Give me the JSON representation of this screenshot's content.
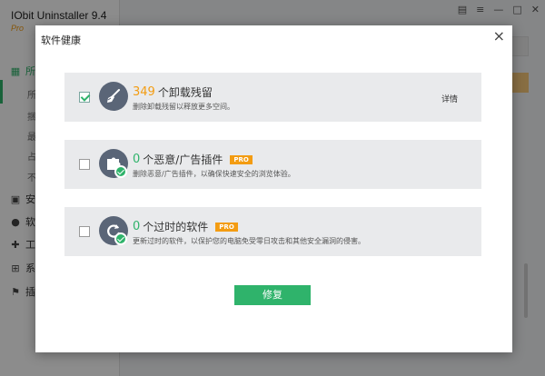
{
  "background_app": {
    "title": "IObit Uninstaller 9.4",
    "edition": "Pro",
    "nav": [
      {
        "icon": "grid-icon",
        "label": "所"
      },
      {
        "icon": "shield-icon",
        "label": "安"
      },
      {
        "icon": "software-icon",
        "label": "软"
      },
      {
        "icon": "tools-icon",
        "label": "工"
      },
      {
        "icon": "windows-icon",
        "label": "系"
      },
      {
        "icon": "flag-icon",
        "label": "插"
      }
    ],
    "subnav": [
      "所",
      "捆",
      "最",
      "占",
      "不"
    ]
  },
  "dialog": {
    "title": "软件健康",
    "close_glyph": "×",
    "cards": [
      {
        "count": "349",
        "headline": "个卸载残留",
        "description": "删除卸载残留以释放更多空间。",
        "checked": true,
        "details_label": "详情",
        "icon": "broom-icon"
      },
      {
        "count": "0",
        "headline": "个恶意/广告插件",
        "badge": "PRO",
        "description": "删除恶意/广告插件，以确保快速安全的浏览体验。",
        "checked": false,
        "icon": "puzzle-icon"
      },
      {
        "count": "0",
        "headline": "个过时的软件",
        "badge": "PRO",
        "description": "更新过时的软件，以保护您的电脑免受零日攻击和其他安全漏洞的侵害。",
        "checked": false,
        "icon": "refresh-icon"
      }
    ],
    "fix_label": "修复"
  },
  "colors": {
    "accent_green": "#2fb36b",
    "accent_orange": "#f39c12",
    "icon_bg": "#5a6577"
  }
}
